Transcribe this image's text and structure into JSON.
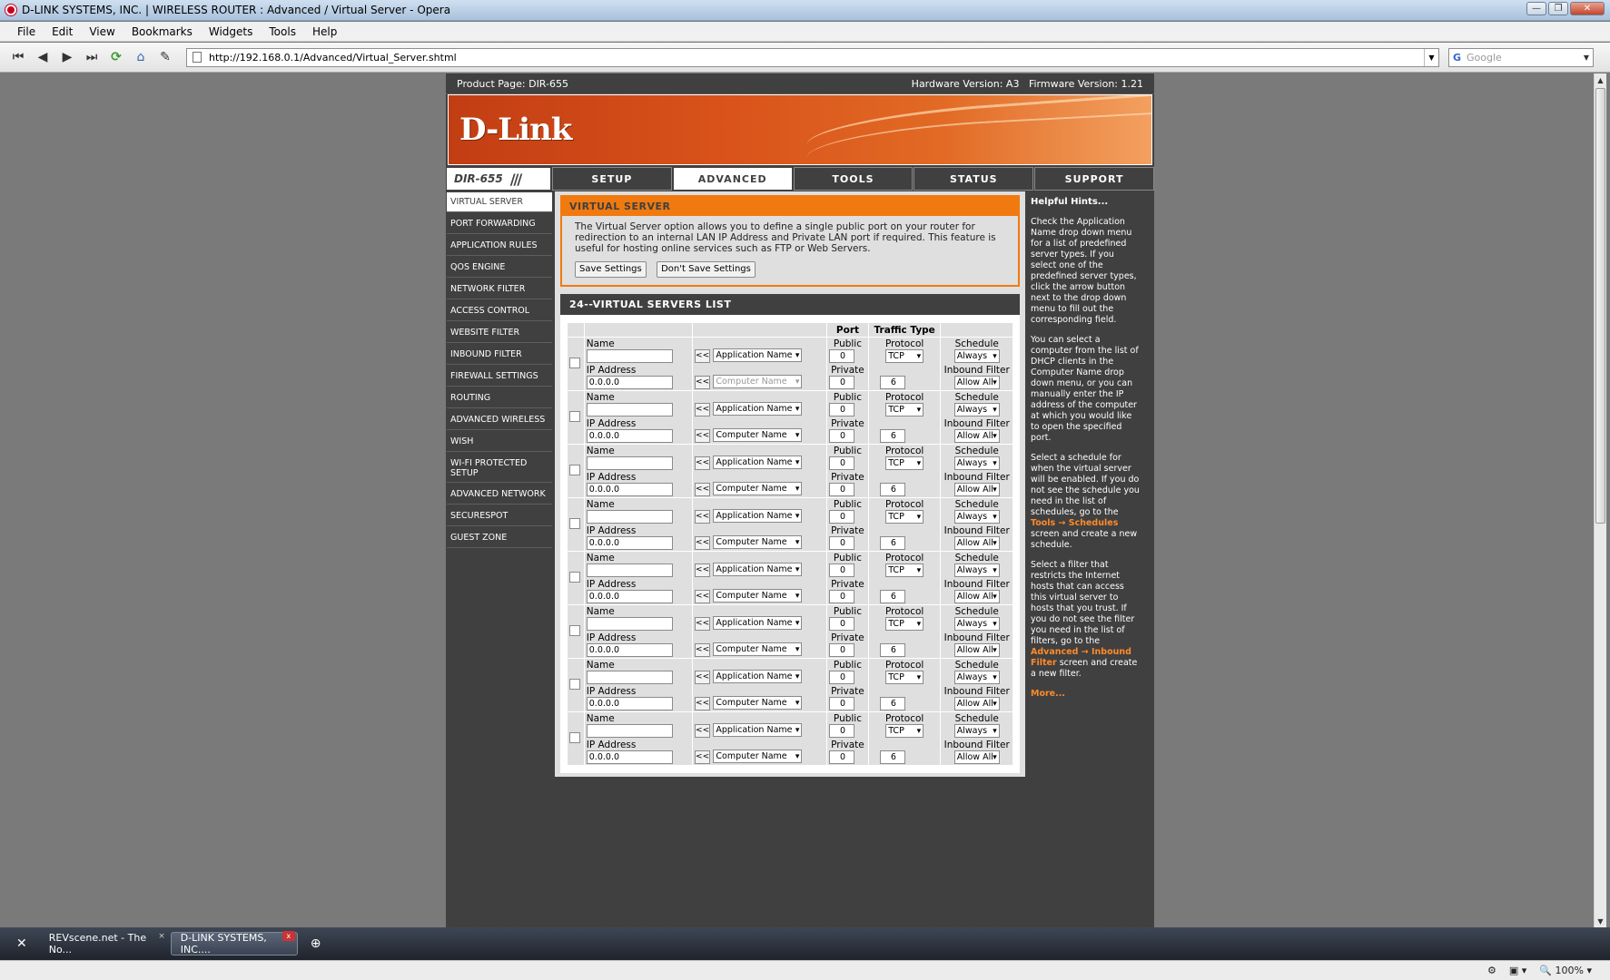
{
  "window": {
    "title": "D-LINK SYSTEMS, INC. | WIRELESS ROUTER : Advanced / Virtual Server - Opera"
  },
  "menubar": [
    "File",
    "Edit",
    "View",
    "Bookmarks",
    "Widgets",
    "Tools",
    "Help"
  ],
  "address": {
    "url": "http://192.168.0.1/Advanced/Virtual_Server.shtml",
    "search_placeholder": "Google"
  },
  "router": {
    "product_page": "Product Page: DIR-655",
    "hw_fw": "Hardware Version: A3   Firmware Version: 1.21",
    "logo": "D-Link",
    "model": "DIR-655",
    "tabs": [
      "SETUP",
      "ADVANCED",
      "TOOLS",
      "STATUS",
      "SUPPORT"
    ],
    "nav": [
      "VIRTUAL SERVER",
      "PORT FORWARDING",
      "APPLICATION RULES",
      "QOS ENGINE",
      "NETWORK FILTER",
      "ACCESS CONTROL",
      "WEBSITE FILTER",
      "INBOUND FILTER",
      "FIREWALL SETTINGS",
      "ROUTING",
      "ADVANCED WIRELESS",
      "WISH",
      "WI-FI PROTECTED SETUP",
      "ADVANCED NETWORK",
      "SECURESPOT",
      "GUEST ZONE"
    ],
    "vs": {
      "title": "VIRTUAL SERVER",
      "desc": "The Virtual Server option allows you to define a single public port on your router for redirection to an internal LAN IP Address and Private LAN port if required. This feature is useful for hosting online services such as FTP or Web Servers.",
      "save": "Save Settings",
      "dont_save": "Don't Save Settings"
    },
    "list": {
      "title": "24--VIRTUAL SERVERS LIST",
      "hdr_port": "Port",
      "hdr_traffic": "Traffic Type",
      "lbl_name": "Name",
      "lbl_ip": "IP Address",
      "lbl_public": "Public",
      "lbl_private": "Private",
      "lbl_protocol": "Protocol",
      "lbl_schedule": "Schedule",
      "lbl_inbound": "Inbound Filter",
      "ip_value": "0.0.0.0",
      "port_value": "0",
      "proto_num": "6",
      "app_name": "Application Name",
      "comp_name": "Computer Name",
      "proto": "TCP",
      "sched": "Always",
      "filter": "Allow All",
      "arrow": "<<"
    },
    "hints": {
      "title": "Helpful Hints...",
      "p1": "Check the Application Name drop down menu for a list of predefined server types. If you select one of the predefined server types, click the arrow button next to the drop down menu to fill out the corresponding field.",
      "p2": "You can select a computer from the list of DHCP clients in the Computer Name drop down menu, or you can manually enter the IP address of the computer at which you would like to open the specified port.",
      "p3a": "Select a schedule for when the virtual server will be enabled. If you do not see the schedule you need in the list of schedules, go to the",
      "p3link": "Tools → Schedules",
      "p3b": "screen and create a new schedule.",
      "p4a": "Select a filter that restricts the Internet hosts that can access this virtual server to hosts that you trust. If you do not see the filter you need in the list of filters, go to the",
      "p4link": "Advanced → Inbound Filter",
      "p4b": "screen and create a new filter.",
      "more": "More..."
    }
  },
  "taskbar": {
    "tab1": "REVscene.net - The No...",
    "tab2": "D-LINK SYSTEMS, INC...."
  },
  "status": {
    "zoom": "100%"
  }
}
